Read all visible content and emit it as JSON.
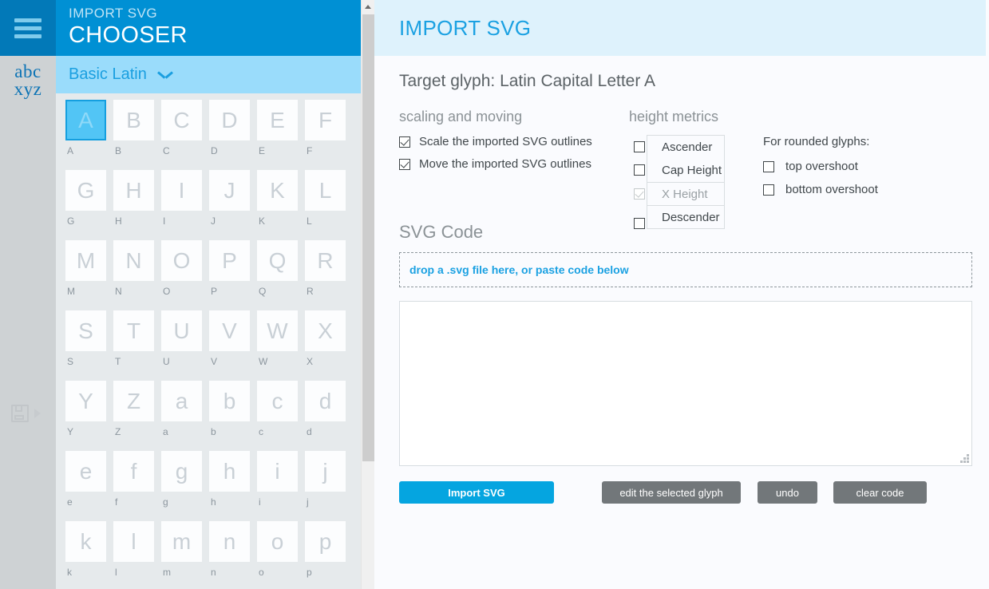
{
  "rail": {
    "menu_icon": "hamburger-icon",
    "logo_line1": "abc",
    "logo_line2": "xyz",
    "save_icon": "save-floppy-icon",
    "play_icon": "play-triangle-icon"
  },
  "chooser": {
    "subtitle": "IMPORT SVG",
    "title": "CHOOSER",
    "group": "Basic Latin",
    "chevron_icon": "chevron-down-icon",
    "selected_glyph": "A",
    "glyphs": [
      "A",
      "B",
      "C",
      "D",
      "E",
      "F",
      "G",
      "H",
      "I",
      "J",
      "K",
      "L",
      "M",
      "N",
      "O",
      "P",
      "Q",
      "R",
      "S",
      "T",
      "U",
      "V",
      "W",
      "X",
      "Y",
      "Z",
      "a",
      "b",
      "c",
      "d",
      "e",
      "f",
      "g",
      "h",
      "i",
      "j",
      "k",
      "l",
      "m",
      "n",
      "o",
      "p"
    ]
  },
  "main": {
    "header_title": "IMPORT SVG",
    "target_glyph_label": "Target glyph: Latin Capital Letter A",
    "scaling": {
      "heading": "scaling and moving",
      "options": [
        {
          "label": "Scale the imported SVG outlines",
          "checked": true,
          "disabled": false
        },
        {
          "label": "Move the imported SVG outlines",
          "checked": true,
          "disabled": false
        }
      ]
    },
    "height_metrics": {
      "heading": "height metrics",
      "options": [
        {
          "label": "Ascender",
          "checked": false,
          "disabled": false
        },
        {
          "label": "Cap Height",
          "checked": false,
          "disabled": false
        },
        {
          "label": "X Height",
          "checked": true,
          "disabled": true
        },
        {
          "label": "Descender",
          "checked": false,
          "disabled": false
        }
      ]
    },
    "rounded": {
      "heading": "For rounded glyphs:",
      "options": [
        {
          "label": "top overshoot",
          "checked": false
        },
        {
          "label": "bottom overshoot",
          "checked": false
        }
      ]
    },
    "svg_code": {
      "heading": "SVG Code",
      "dropzone_text": "drop a .svg file here, or paste code below",
      "textarea_value": "",
      "textarea_placeholder": ""
    },
    "buttons": {
      "import": "Import SVG",
      "edit": "edit the selected glyph",
      "undo": "undo",
      "clear": "clear code"
    }
  },
  "colors": {
    "accent": "#05a5e0",
    "header_blue": "#0090d4",
    "rail_blue": "#0279b8",
    "group_bar": "#9adcfb",
    "panel_header": "#def2fc",
    "selection": "#52c5f5"
  }
}
